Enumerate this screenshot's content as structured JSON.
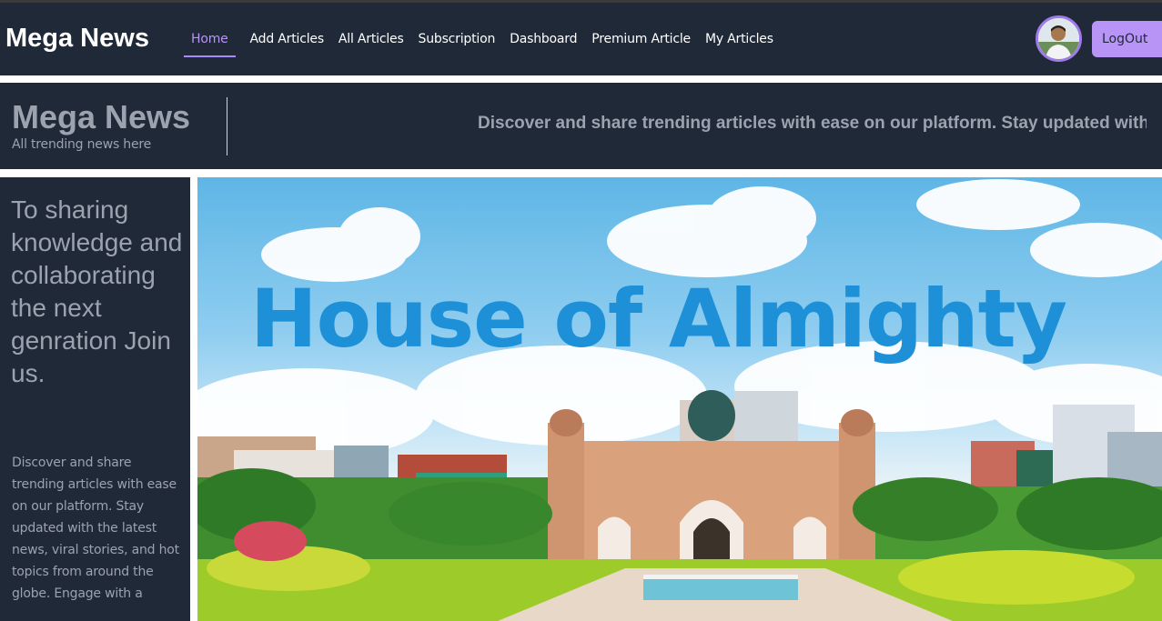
{
  "navbar": {
    "brand": "Mega News",
    "links": [
      {
        "label": "Home",
        "active": true
      },
      {
        "label": "Add Articles"
      },
      {
        "label": "All Articles"
      },
      {
        "label": "Subscription"
      },
      {
        "label": "Dashboard"
      },
      {
        "label": "Premium Article"
      },
      {
        "label": "My Articles"
      }
    ],
    "logout_label": "LogOut"
  },
  "banner": {
    "title": "Mega News",
    "subtitle": "All trending news here",
    "marquee": "Discover and share trending articles with ease on our platform. Stay updated with"
  },
  "sidebar": {
    "heading": "To sharing knowledge and collaborating the next genration Join us.",
    "body": "Discover and share trending articles with ease on our platform. Stay updated with the latest news, viral stories, and hot topics from around the globe. Engage with a"
  },
  "hero": {
    "heading": "House of Almighty"
  },
  "colors": {
    "nav_bg": "#1f2937",
    "accent": "#b794f6",
    "muted_text": "#9ca3af"
  }
}
